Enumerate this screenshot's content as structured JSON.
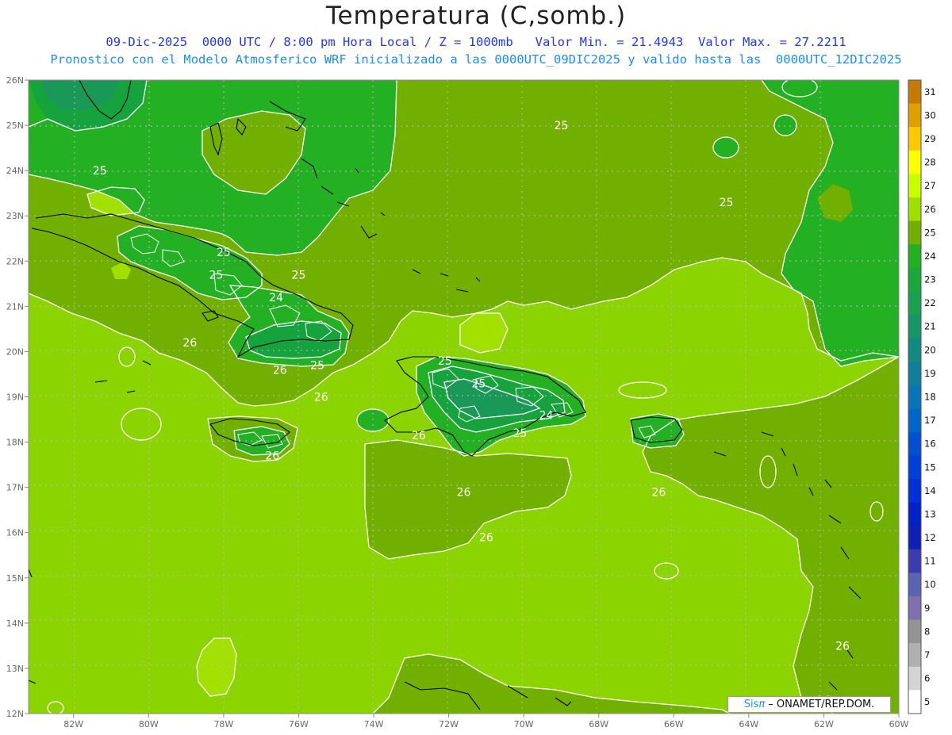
{
  "header": {
    "title": "Temperatura (C,somb.)",
    "subtitle_line1": "09-Dic-2025  0000 UTC / 8:00 pm Hora Local / Z = 1000mb   Valor Min. = 21.4943  Valor Max. = 27.2211",
    "subtitle_line2": "Pronostico con el Modelo Atmosferico WRF inicializado a las 0000UTC_09DIC2025 y valido hasta las  0000UTC_12DIC2025"
  },
  "map": {
    "lat_labels": [
      "26N",
      "25N",
      "24N",
      "23N",
      "22N",
      "21N",
      "20N",
      "19N",
      "18N",
      "17N",
      "16N",
      "15N",
      "14N",
      "13N",
      "12N"
    ],
    "lon_labels": [
      "82W",
      "80W",
      "78W",
      "76W",
      "74W",
      "72W",
      "70W",
      "68W",
      "66W",
      "64W",
      "62W",
      "60W"
    ],
    "lat_range": [
      12,
      26
    ],
    "lon_range": [
      -83.2,
      -60
    ],
    "contour_labels": [
      {
        "text": "25",
        "lon": -81.3,
        "lat": 24.0
      },
      {
        "text": "25",
        "lon": -69.0,
        "lat": 25.0
      },
      {
        "text": "25",
        "lon": -64.6,
        "lat": 23.3
      },
      {
        "text": "25",
        "lon": -78.0,
        "lat": 22.2
      },
      {
        "text": "25",
        "lon": -76.0,
        "lat": 21.7
      },
      {
        "text": "25",
        "lon": -78.2,
        "lat": 21.7
      },
      {
        "text": "24",
        "lon": -76.6,
        "lat": 21.2
      },
      {
        "text": "26",
        "lon": -78.9,
        "lat": 20.2
      },
      {
        "text": "26",
        "lon": -76.5,
        "lat": 19.6
      },
      {
        "text": "25",
        "lon": -75.5,
        "lat": 19.7
      },
      {
        "text": "26",
        "lon": -75.4,
        "lat": 19.0
      },
      {
        "text": "25",
        "lon": -72.1,
        "lat": 19.8
      },
      {
        "text": "25",
        "lon": -71.2,
        "lat": 19.3
      },
      {
        "text": "24",
        "lon": -69.4,
        "lat": 18.6
      },
      {
        "text": "25",
        "lon": -70.1,
        "lat": 18.2
      },
      {
        "text": "26",
        "lon": -72.8,
        "lat": 18.15
      },
      {
        "text": "26",
        "lon": -76.7,
        "lat": 17.7
      },
      {
        "text": "26",
        "lon": -71.6,
        "lat": 16.9
      },
      {
        "text": "26",
        "lon": -66.4,
        "lat": 16.9
      },
      {
        "text": "26",
        "lon": -71.0,
        "lat": 15.9
      },
      {
        "text": "26",
        "lon": -61.5,
        "lat": 13.5
      },
      {
        "text": "26",
        "lon": -62.0,
        "lat": 12.3
      }
    ]
  },
  "colorbar": {
    "levels": [
      "31",
      "30",
      "29",
      "28",
      "27",
      "26",
      "25",
      "24",
      "23",
      "22",
      "21",
      "20",
      "19",
      "18",
      "17",
      "16",
      "15",
      "14",
      "13",
      "12",
      "11",
      "10",
      "9",
      "8",
      "7",
      "6",
      "5"
    ],
    "colors": [
      "#c57a00",
      "#e0a000",
      "#ffc800",
      "#ffff00",
      "#c8ff00",
      "#a0e000",
      "#72b000",
      "#23b023",
      "#1aa83a",
      "#19a050",
      "#169668",
      "#128a80",
      "#10809a",
      "#0a74b8",
      "#0066cc",
      "#0050d0",
      "#0040d8",
      "#0030d8",
      "#0020c8",
      "#1020b4",
      "#3a3cb0",
      "#5a64b4",
      "#8070b0",
      "#949494",
      "#b0b0b0",
      "#d4d4d4",
      "#ffffff"
    ]
  },
  "credit": {
    "brand": "Sis",
    "pi": "π",
    "org": " – ONAMET/REP.DOM."
  },
  "palette": {
    "t27": "#a2d800",
    "t26": "#8cd400",
    "t25": "#72b000",
    "t24": "#23b023",
    "t23": "#16a23c",
    "t22": "#1a9858",
    "contour": "#ffffff",
    "coast": "#000000",
    "grid": "#bcbcbc"
  }
}
